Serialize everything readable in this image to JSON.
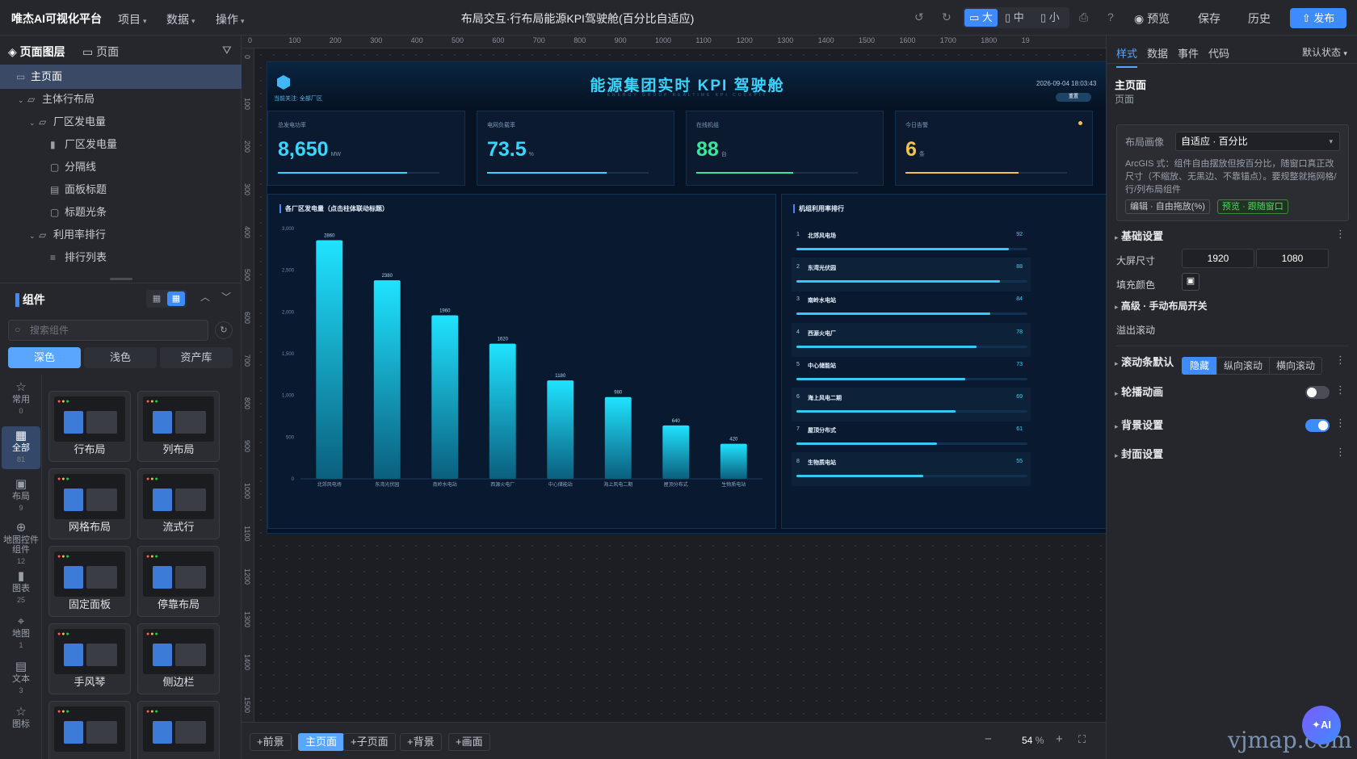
{
  "app": {
    "name": "唯杰AI可视化平台"
  },
  "topbar": {
    "menus": [
      "项目",
      "数据",
      "操作"
    ],
    "doc_title": "布局交互·行布局能源KPI驾驶舱(百分比自适应)",
    "devices": [
      "大",
      "中",
      "小"
    ],
    "preview": "预览",
    "save": "保存",
    "history": "历史",
    "publish": "发布"
  },
  "left": {
    "tabs": [
      "页面图层",
      "页面"
    ],
    "tree": [
      {
        "label": "主页面",
        "icon": "monitor-icon",
        "depth": 0,
        "selected": true
      },
      {
        "label": "主体行布局",
        "icon": "folder-icon",
        "depth": 1,
        "expand": true
      },
      {
        "label": "厂区发电量",
        "icon": "folder-icon",
        "depth": 2,
        "expand": true
      },
      {
        "label": "厂区发电量",
        "icon": "bar-chart-icon",
        "depth": 3
      },
      {
        "label": "分隔线",
        "icon": "component-icon",
        "depth": 3
      },
      {
        "label": "面板标题",
        "icon": "document-icon",
        "depth": 3
      },
      {
        "label": "标题光条",
        "icon": "component-icon",
        "depth": 3
      },
      {
        "label": "利用率排行",
        "icon": "folder-icon",
        "depth": 2,
        "expand": true
      },
      {
        "label": "排行列表",
        "icon": "list-icon",
        "depth": 3
      }
    ],
    "components_title": "组件",
    "search_placeholder": "搜索组件",
    "theme_tabs": [
      "深色",
      "浅色",
      "资产库"
    ],
    "categories": [
      {
        "label": "常用",
        "count": "0",
        "icon": "star-icon"
      },
      {
        "label": "全部",
        "count": "81",
        "icon": "grid-icon"
      },
      {
        "label": "布局",
        "count": "9",
        "icon": "layout-icon"
      },
      {
        "label": "地图控件组件",
        "count": "12",
        "icon": "map-control-icon"
      },
      {
        "label": "图表",
        "count": "25",
        "icon": "chart-icon"
      },
      {
        "label": "地图",
        "count": "1",
        "icon": "map-pin-icon"
      },
      {
        "label": "文本",
        "count": "3",
        "icon": "text-icon"
      },
      {
        "label": "图标",
        "count": "",
        "icon": "star-icon"
      }
    ],
    "cards": [
      "行布局",
      "列布局",
      "网格布局",
      "流式行",
      "固定面板",
      "停靠布局",
      "手风琴",
      "侧边栏",
      "",
      ""
    ]
  },
  "rulers": {
    "top": [
      "0",
      "100",
      "200",
      "300",
      "400",
      "500",
      "600",
      "700",
      "800",
      "900",
      "1000",
      "1100",
      "1200",
      "1300",
      "1400",
      "1500",
      "1600",
      "1700",
      "1800",
      "19"
    ],
    "left": [
      "0",
      "100",
      "200",
      "300",
      "400",
      "500",
      "600",
      "700",
      "800",
      "900",
      "1000",
      "1100",
      "1200",
      "1300",
      "1400",
      "1500"
    ]
  },
  "screen": {
    "title": "能源集团实时 KPI 驾驶舱",
    "subtitle": "ENERGY GROUP REALTIME KPI COCKPIT",
    "focus": "当前关注: 全部厂区",
    "time": "2026-09-04 18:03:43",
    "reset": "重置",
    "kpis": [
      {
        "label": "总发电功率",
        "value": "8,650",
        "unit": "MW",
        "color": "#39d5ff",
        "fill": 0.8
      },
      {
        "label": "电网负载率",
        "value": "73.5",
        "unit": "%",
        "color": "#39d5ff",
        "fill": 0.74
      },
      {
        "label": "在线机组",
        "value": "88",
        "unit": "台",
        "color": "#39e6a0",
        "fill": 0.6
      },
      {
        "label": "今日告警",
        "value": "6",
        "unit": "条",
        "color": "#f2c14e",
        "fill": 0.7
      }
    ],
    "chart_title": "各厂区发电量（点击柱体联动标题）",
    "rank_title": "机组利用率排行",
    "ranking": [
      {
        "rank": "1",
        "name": "北郊风电场",
        "value": "92"
      },
      {
        "rank": "2",
        "name": "东湾光伏园",
        "value": "88"
      },
      {
        "rank": "3",
        "name": "南岭水电站",
        "value": "84"
      },
      {
        "rank": "4",
        "name": "西源火电厂",
        "value": "78"
      },
      {
        "rank": "5",
        "name": "中心储能站",
        "value": "73"
      },
      {
        "rank": "6",
        "name": "海上风电二期",
        "value": "69"
      },
      {
        "rank": "7",
        "name": "屋顶分布式",
        "value": "61"
      },
      {
        "rank": "8",
        "name": "生物质电站",
        "value": "55"
      }
    ]
  },
  "chart_data": {
    "type": "bar",
    "title": "各厂区发电量（点击柱体联动标题）",
    "categories": [
      "北郊风电场",
      "东湾光伏园",
      "南岭水电站",
      "西源火电厂",
      "中心储能站",
      "海上风电二期",
      "屋顶分布式",
      "生物质电站"
    ],
    "values": [
      2860,
      2380,
      1960,
      1620,
      1180,
      980,
      640,
      420
    ],
    "yticks": [
      "0",
      "500",
      "1,000",
      "1,500",
      "2,000",
      "2,500",
      "3,000"
    ],
    "ylim": [
      0,
      3000
    ],
    "grid": false,
    "bar_color": "#18d6f0"
  },
  "bottom": {
    "buttons": [
      "+前景",
      "主页面",
      "+子页面",
      "+背景",
      "+画面"
    ],
    "zoom": "54",
    "zoom_unit": "%"
  },
  "right": {
    "tabs": [
      "样式",
      "数据",
      "事件",
      "代码"
    ],
    "state": "默认状态",
    "page_title": "主页面",
    "page_sub": "页面",
    "layout_label": "布局画像",
    "layout_value": "自适应 · 百分比",
    "layout_desc": "ArcGIS 式：组件自由摆放但按百分比，随窗口真正改尺寸（不缩放、无黑边、不靠锚点）。要规整就拖网格/行/列布局组件",
    "chip_edit": "编辑 · 自由拖放(%)",
    "chip_preview": "预览 · 跟随窗口",
    "basic": "基础设置",
    "size_label": "大屏尺寸",
    "width": "1920",
    "height": "1080",
    "fill_label": "填充颜色",
    "advanced": "高级 · 手动布局开关",
    "overflow_label": "溢出滚动",
    "overflow_opts": [
      "隐藏",
      "纵向滚动",
      "横向滚动"
    ],
    "scrollbar": "滚动条默认",
    "carousel": "轮播动画",
    "background": "背景设置",
    "cover": "封面设置"
  },
  "ai": {
    "label": "AI"
  },
  "watermark": "vjmap.com"
}
